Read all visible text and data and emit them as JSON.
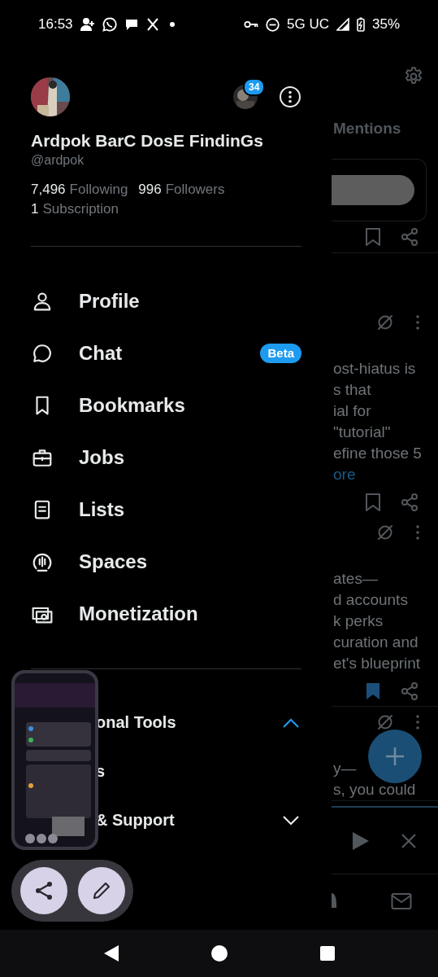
{
  "status_bar": {
    "time": "16:53",
    "network": "5G UC",
    "battery": "35%"
  },
  "drawer": {
    "name": "Ardpok BarC DosE FindinGs",
    "handle": "@ardpok",
    "account_badge": "34",
    "stats": [
      {
        "count": "7,496",
        "label": "Following"
      },
      {
        "count": "996",
        "label": "Followers"
      },
      {
        "count": "1",
        "label": "Subscription"
      }
    ],
    "menu": [
      {
        "label": "Profile"
      },
      {
        "label": "Chat",
        "badge": "Beta"
      },
      {
        "label": "Bookmarks"
      },
      {
        "label": "Jobs"
      },
      {
        "label": "Lists"
      },
      {
        "label": "Spaces"
      },
      {
        "label": "Monetization"
      }
    ],
    "sections": [
      {
        "label": "onal Tools",
        "expanded": true,
        "children": [
          {
            "label": "s"
          }
        ]
      },
      {
        "label": "& Support",
        "expanded": false
      }
    ]
  },
  "feed": {
    "tab": "Mentions",
    "posts": [
      {
        "kind": "card",
        "bookmarked": false
      },
      {
        "kind": "text",
        "lines": [
          "ost-hiatus is",
          "s that",
          "ial for",
          "\"tutorial\"",
          "efine those 5"
        ],
        "more": "ore",
        "bookmarked": false
      },
      {
        "kind": "text",
        "lines": [
          "ates—",
          "d accounts",
          "k perks",
          "curation and",
          "et's blueprint"
        ],
        "bookmarked": true
      },
      {
        "kind": "text",
        "lines": [
          "y—",
          "s, you could"
        ]
      }
    ]
  }
}
